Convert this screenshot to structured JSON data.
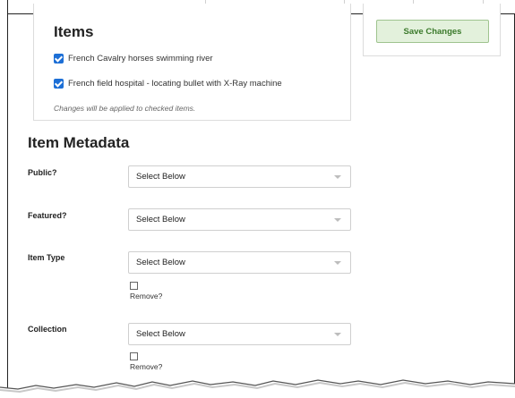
{
  "items_panel": {
    "title": "Items",
    "checked_items": [
      {
        "label": "French Cavalry horses swimming river",
        "checked": true
      },
      {
        "label": "French field hospital - locating bullet with X-Ray machine",
        "checked": true
      }
    ],
    "note": "Changes will be applied to checked items."
  },
  "save_panel": {
    "save_label": "Save Changes"
  },
  "metadata": {
    "title": "Item Metadata",
    "fields": [
      {
        "label": "Public?",
        "selected": "Select Below"
      },
      {
        "label": "Featured?",
        "selected": "Select Below"
      },
      {
        "label": "Item Type",
        "selected": "Select Below",
        "remove_label": "Remove?"
      },
      {
        "label": "Collection",
        "selected": "Select Below",
        "remove_label": "Remove?"
      }
    ]
  },
  "colors": {
    "checkbox": "#1d6fd6",
    "save_bg": "#e3f1dc",
    "save_text": "#3b7a2b"
  }
}
